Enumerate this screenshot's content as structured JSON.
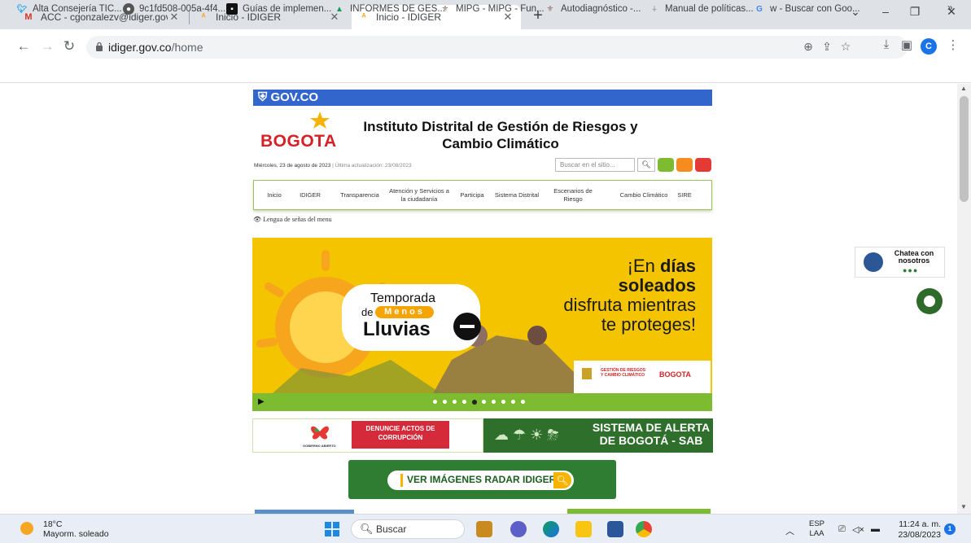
{
  "browser": {
    "tabs": [
      {
        "title": "ACC - cgonzalezv@idiger.gov.co",
        "favicon": "gmail-icon"
      },
      {
        "title": "Inicio - IDIGER",
        "favicon": "idiger-icon"
      },
      {
        "title": "Inicio - IDIGER",
        "favicon": "idiger-icon",
        "active": true
      }
    ],
    "url_host": "idiger.gov.co",
    "url_path": "/home",
    "profile_initial": "C",
    "bookmarks": [
      "Alta Consejería TIC...",
      "9c1fd508-005a-4f4...",
      "Guías de implemen...",
      "INFORMES DE GES...",
      "MIPG - MIPG - Fun...",
      "Autodiagnóstico -...",
      "Manual de políticas...",
      "w - Buscar con Goo..."
    ],
    "bookmarks_overflow": "»"
  },
  "page": {
    "gov_bar": "GOV.CO",
    "logo_text": "BOGOTA",
    "institute_title": "Instituto Distrital de Gestión de Riesgos y Cambio Climático",
    "date": "Miércoles, 23 de agosto de 2023",
    "last_update": "| Última actualización: 23/08/2023",
    "search_placeholder": "Buscar en el sitio...",
    "menu": [
      "Inicio",
      "IDIGER",
      "Transparencia",
      "Atención y Servicios a la ciudadanía",
      "Participa",
      "Sistema Distrital",
      "Escenarios de Riesgo",
      "Cambio Climático",
      "SIRE"
    ],
    "sign_language": "Lengua de señas del menu",
    "banner": {
      "line1": "¡En",
      "line1_bold": "días",
      "line2_bold": "soleados",
      "line3": "disfruta mientras",
      "line4": "te proteges!",
      "season_top": "Temporada",
      "season_de": "de",
      "season_pill": "Menos",
      "season_bottom": "Lluvias",
      "logo_mid": "GESTIÓN DE RIESGOS Y CAMBIO CLIMÁTICO",
      "logo_right": "BOGOTA",
      "slides_total": 10,
      "slide_active": 5
    },
    "corruption": "DENUNCIE ACTOS DE CORRUPCIÓN",
    "gobierno_abierto": "GOBIERNO ABIERTO",
    "sab": "SISTEMA DE ALERTA DE BOGOTÁ - SAB",
    "radar": "VER IMÁGENES RADAR IDIGER",
    "chat": "Chatea con nosotros"
  },
  "taskbar": {
    "temperature": "18°C",
    "weather": "Mayorm. soleado",
    "search": "Buscar",
    "lang": "ESP",
    "lang2": "LAA",
    "time": "11:24 a. m.",
    "date": "23/08/2023",
    "notifications": "1"
  },
  "colors": {
    "gov_blue": "#3366cc",
    "bogota_red": "#d62128",
    "banner_yellow": "#f5c400",
    "idiger_green": "#7dbb31"
  }
}
